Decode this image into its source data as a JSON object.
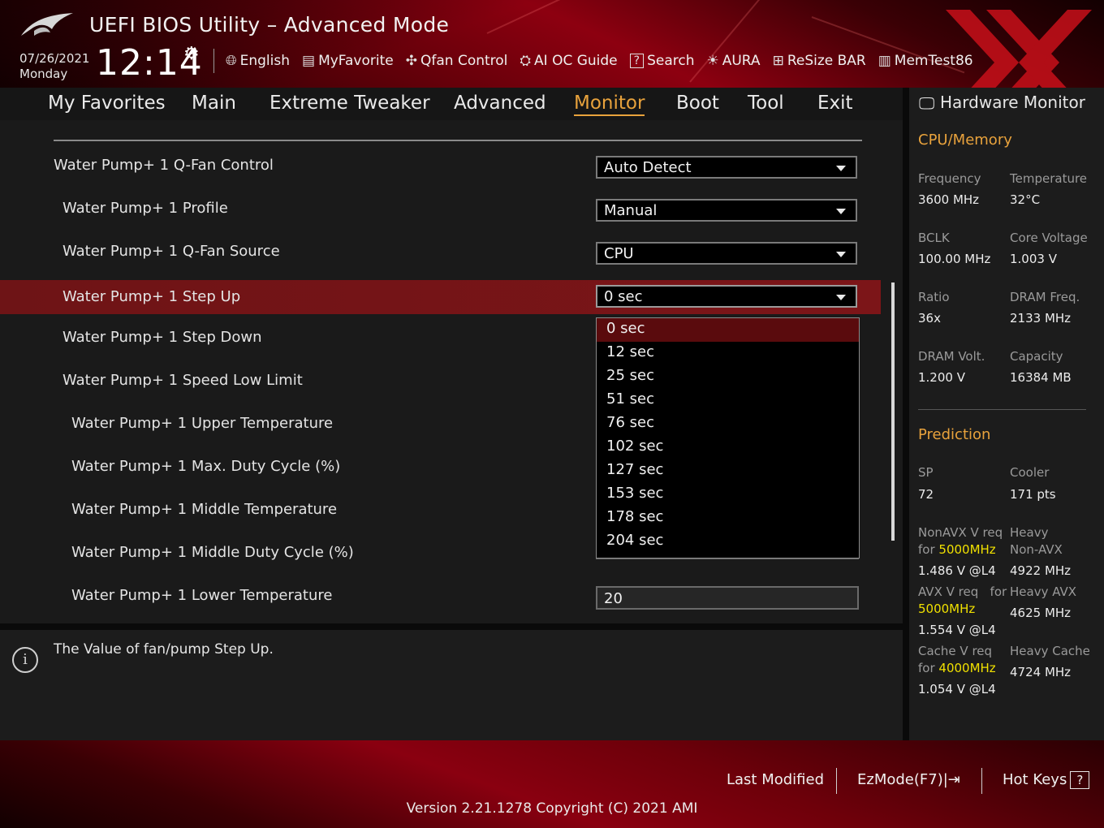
{
  "header": {
    "title": "UEFI BIOS Utility – Advanced Mode",
    "date": "07/26/2021",
    "day": "Monday",
    "time": "12:14",
    "toolbar": [
      {
        "label": "English",
        "icon": "globe-icon"
      },
      {
        "label": "MyFavorite",
        "icon": "favorite-icon"
      },
      {
        "label": "Qfan Control",
        "icon": "fan-icon"
      },
      {
        "label": "AI OC Guide",
        "icon": "ai-icon"
      },
      {
        "label": "Search",
        "icon": "search-icon"
      },
      {
        "label": "AURA",
        "icon": "aura-icon"
      },
      {
        "label": "ReSize BAR",
        "icon": "resize-bar-icon"
      },
      {
        "label": "MemTest86",
        "icon": "memtest-icon"
      }
    ]
  },
  "menu": {
    "items": [
      "My Favorites",
      "Main",
      "Extreme Tweaker",
      "Advanced",
      "Monitor",
      "Boot",
      "Tool",
      "Exit"
    ],
    "active": "Monitor"
  },
  "settings": [
    {
      "label": "Water Pump+ 1 Q-Fan Control",
      "value": "Auto Detect",
      "kind": "select"
    },
    {
      "label": "Water Pump+ 1 Profile",
      "value": "Manual",
      "kind": "select"
    },
    {
      "label": "Water Pump+ 1 Q-Fan Source",
      "value": "CPU",
      "kind": "select"
    },
    {
      "label": "Water Pump+ 1 Step Up",
      "value": "0 sec",
      "kind": "select"
    },
    {
      "label": "Water Pump+ 1 Step Down",
      "value": "",
      "kind": "hidden"
    },
    {
      "label": "Water Pump+ 1 Speed Low Limit",
      "value": "",
      "kind": "hidden"
    },
    {
      "label": "Water Pump+ 1 Upper Temperature",
      "value": "",
      "kind": "hidden"
    },
    {
      "label": "Water Pump+ 1 Max. Duty Cycle (%)",
      "value": "",
      "kind": "hidden"
    },
    {
      "label": "Water Pump+ 1 Middle Temperature",
      "value": "",
      "kind": "hidden"
    },
    {
      "label": "Water Pump+ 1 Middle Duty Cycle (%)",
      "value": "",
      "kind": "hidden"
    },
    {
      "label": "Water Pump+ 1 Lower Temperature",
      "value": "20",
      "kind": "number"
    }
  ],
  "dropdown": {
    "options": [
      "0 sec",
      "12 sec",
      "25 sec",
      "51 sec",
      "76 sec",
      "102 sec",
      "127 sec",
      "153 sec",
      "178 sec",
      "204 sec"
    ],
    "selected": "0 sec"
  },
  "help": {
    "text": "The Value of fan/pump Step Up."
  },
  "hwmon": {
    "title": "Hardware Monitor",
    "cpu_memory": {
      "heading": "CPU/Memory",
      "frequency_label": "Frequency",
      "frequency": "3600 MHz",
      "temperature_label": "Temperature",
      "temperature": "32°C",
      "bclk_label": "BCLK",
      "bclk": "100.00 MHz",
      "core_voltage_label": "Core Voltage",
      "core_voltage": "1.003 V",
      "ratio_label": "Ratio",
      "ratio": "36x",
      "dram_freq_label": "DRAM Freq.",
      "dram_freq": "2133 MHz",
      "dram_volt_label": "DRAM Volt.",
      "dram_volt": "1.200 V",
      "capacity_label": "Capacity",
      "capacity": "16384 MB"
    },
    "prediction": {
      "heading": "Prediction",
      "sp_label": "SP",
      "sp": "72",
      "cooler_label": "Cooler",
      "cooler": "171 pts",
      "nonavx_label": "NonAVX V req",
      "nonavx_for": "for",
      "nonavx_freq": "5000MHz",
      "nonavx_v": "1.486 V @L4",
      "heavy_nonavx_label1": "Heavy",
      "heavy_nonavx_label2": "Non-AVX",
      "heavy_nonavx": "4922 MHz",
      "avx_label": "AVX V req",
      "avx_for": "for",
      "avx_freq": "5000MHz",
      "avx_v": "1.554 V @L4",
      "heavy_avx_label": "Heavy AVX",
      "heavy_avx": "4625 MHz",
      "cache_label": "Cache V req",
      "cache_for": "for",
      "cache_freq": "4000MHz",
      "cache_v": "1.054 V @L4",
      "heavy_cache_label": "Heavy Cache",
      "heavy_cache": "4724 MHz"
    }
  },
  "footer": {
    "last_modified": "Last Modified",
    "ezmode": "EzMode(F7)|",
    "hotkeys": "Hot Keys",
    "version": "Version 2.21.1278 Copyright (C) 2021 AMI"
  },
  "colors": {
    "accent": "#e8a23c",
    "selected_row": "#7c1518",
    "highlight_value": "#f0e000"
  }
}
